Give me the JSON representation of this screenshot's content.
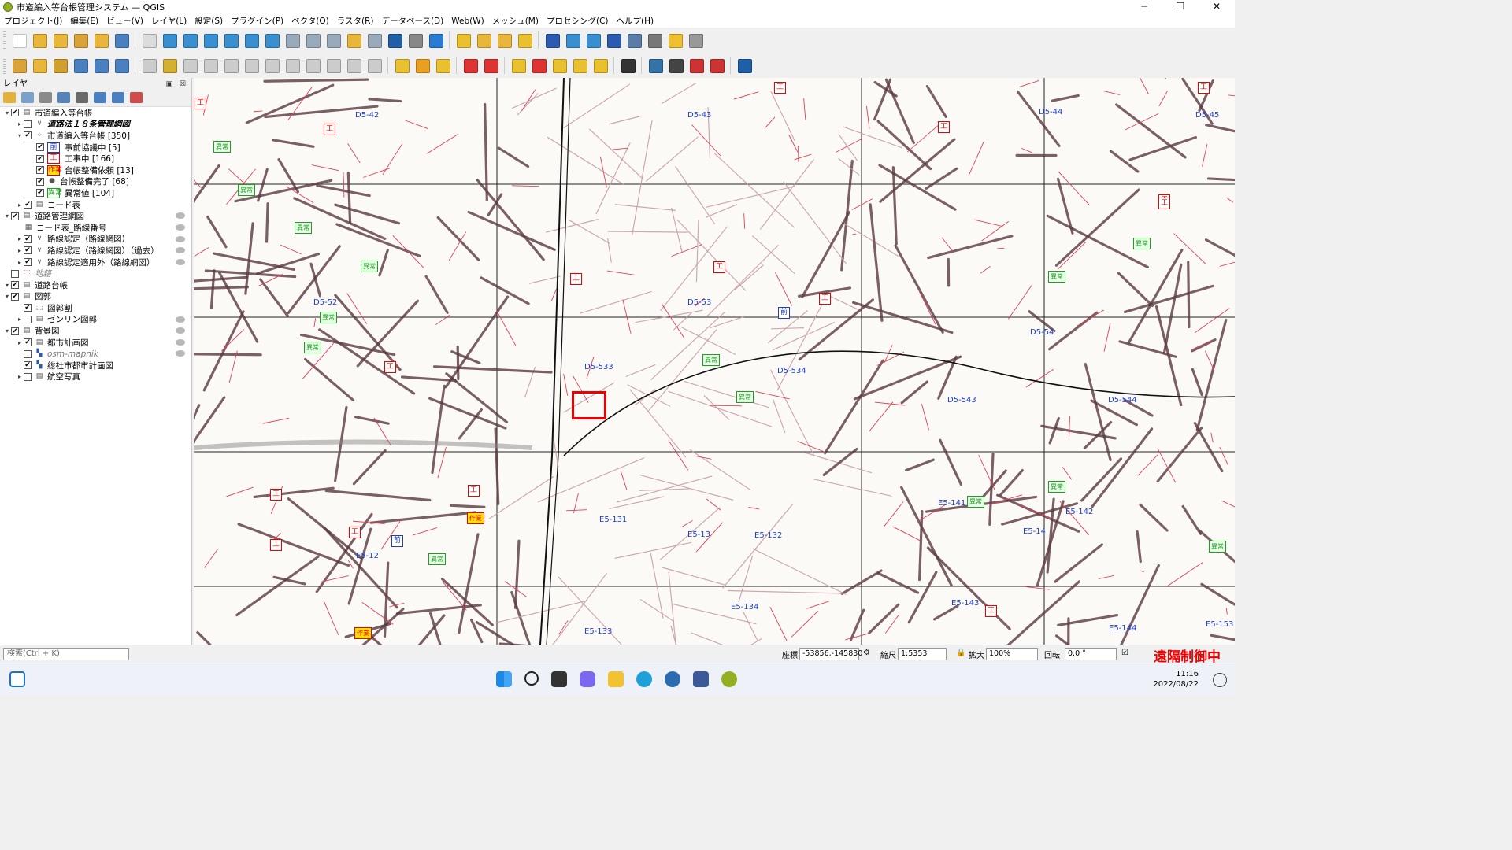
{
  "window": {
    "title": "市道編入等台帳管理システム — QGIS"
  },
  "menu": [
    "プロジェクト(J)",
    "編集(E)",
    "ビュー(V)",
    "レイヤ(L)",
    "設定(S)",
    "プラグイン(P)",
    "ベクタ(O)",
    "ラスタ(R)",
    "データベース(D)",
    "Web(W)",
    "メッシュ(M)",
    "プロセシング(C)",
    "ヘルプ(H)"
  ],
  "layers_panel": {
    "title": "レイヤ",
    "tree": [
      {
        "label": "市道編入等台帳",
        "checked": true,
        "level": 0,
        "kind": "group"
      },
      {
        "label": "道路法１８条管理網図",
        "checked": false,
        "level": 1,
        "kind": "line",
        "style": "italic-bold"
      },
      {
        "label": "市道編入等台帳 [350]",
        "checked": true,
        "level": 1,
        "kind": "point"
      },
      {
        "label": "事前協議中 [5]",
        "checked": true,
        "level": 2,
        "kind": "sym",
        "sym": "前",
        "color": "#1e3cc8"
      },
      {
        "label": "工事中 [166]",
        "checked": true,
        "level": 2,
        "kind": "sym",
        "sym": "工",
        "color": "#e00000"
      },
      {
        "label": "台帳整備依頼 [13]",
        "checked": true,
        "level": 2,
        "kind": "sym",
        "sym": "作業",
        "color": "#e00000",
        "bg": "#ffe000"
      },
      {
        "label": "台帳整備完了 [68]",
        "checked": true,
        "level": 2,
        "kind": "dot"
      },
      {
        "label": "異常値 [104]",
        "checked": true,
        "level": 2,
        "kind": "sym",
        "sym": "異常",
        "color": "#1da01d"
      },
      {
        "label": "コード表",
        "checked": true,
        "level": 1,
        "kind": "group"
      },
      {
        "label": "道路管理網図",
        "checked": true,
        "level": 0,
        "kind": "group"
      },
      {
        "label": "コード表_路線番号",
        "checked": null,
        "level": 1,
        "kind": "table"
      },
      {
        "label": "路線認定（路線網図）",
        "checked": true,
        "level": 1,
        "kind": "line"
      },
      {
        "label": "路線認定（路線網図）（過去）",
        "checked": true,
        "level": 1,
        "kind": "line"
      },
      {
        "label": "路線認定適用外（路線網図）",
        "checked": true,
        "level": 1,
        "kind": "line"
      },
      {
        "label": "地籍",
        "checked": false,
        "level": 0,
        "kind": "poly",
        "style": "italic"
      },
      {
        "label": "道路台帳",
        "checked": true,
        "level": 0,
        "kind": "group"
      },
      {
        "label": "図郭",
        "checked": true,
        "level": 0,
        "kind": "group"
      },
      {
        "label": "図郭割",
        "checked": true,
        "level": 1,
        "kind": "poly"
      },
      {
        "label": "ゼンリン図郭",
        "checked": false,
        "level": 1,
        "kind": "group"
      },
      {
        "label": "背景図",
        "checked": true,
        "level": 0,
        "kind": "group"
      },
      {
        "label": "都市計画図",
        "checked": true,
        "level": 1,
        "kind": "group"
      },
      {
        "label": "osm-mapnik",
        "checked": false,
        "level": 1,
        "kind": "raster",
        "style": "italic"
      },
      {
        "label": "総社市都市計画図",
        "checked": true,
        "level": 1,
        "kind": "raster"
      },
      {
        "label": "航空写真",
        "checked": false,
        "level": 1,
        "kind": "group"
      }
    ]
  },
  "map": {
    "sheet_labels": [
      "D5-42",
      "D5-43",
      "D5-44",
      "D5-45",
      "D5-52",
      "D5-53",
      "D5-533",
      "D5-534",
      "D5-54",
      "D5-543",
      "D5-544",
      "E5-12",
      "E5-131",
      "E5-13",
      "E5-132",
      "E5-134",
      "E5-133",
      "E5-14",
      "E5-141",
      "E5-142",
      "E5-143",
      "E5-144",
      "E5-153"
    ],
    "markers": {
      "kou": "工",
      "mae": "前",
      "ijo": "異常",
      "saku": "作業"
    }
  },
  "status": {
    "search_placeholder": "検索(Ctrl + K)",
    "coord_label": "座標",
    "coord_value": "-53856,-145830",
    "scale_label": "縮尺",
    "scale_value": "1:5353",
    "magnify_label": "拡大",
    "magnify_value": "100%",
    "rotation_label": "回転",
    "rotation_value": "0.0 °",
    "remote_text": "遠隔制御中"
  },
  "clock": {
    "time": "11:16",
    "date": "2022/08/22"
  }
}
